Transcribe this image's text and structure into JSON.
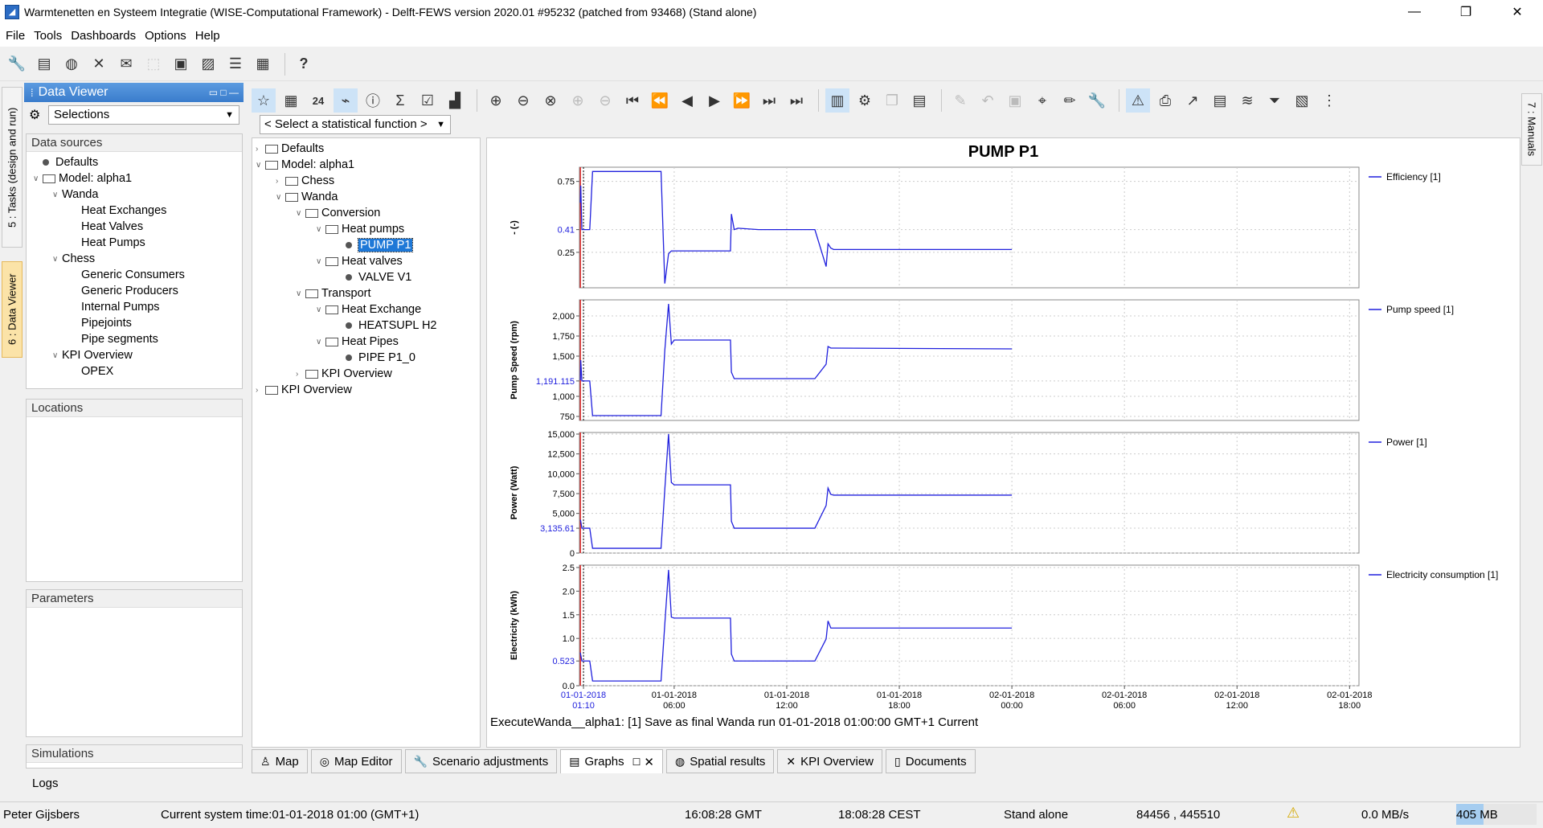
{
  "window": {
    "title": "Warmtenetten en Systeem Integratie (WISE-Computational Framework) - Delft-FEWS version 2020.01 #95232 (patched from 93468)  (Stand alone)"
  },
  "menu": [
    "File",
    "Tools",
    "Dashboards",
    "Options",
    "Help"
  ],
  "side_tabs": {
    "tasks": "5 : Tasks (design and run)",
    "data_viewer": "6 : Data Viewer",
    "manuals": "7 : Manuals"
  },
  "data_viewer": {
    "title": "Data Viewer",
    "selections": "Selections",
    "data_sources_label": "Data sources",
    "data_sources": [
      {
        "label": "Defaults",
        "level": 0,
        "kind": "leaf-dot"
      },
      {
        "label": "Model: alpha1",
        "level": 0,
        "kind": "folder-open"
      },
      {
        "label": "Wanda",
        "level": 1,
        "kind": "open"
      },
      {
        "label": "Heat Exchanges",
        "level": 2,
        "kind": "text"
      },
      {
        "label": "Heat Valves",
        "level": 2,
        "kind": "text"
      },
      {
        "label": "Heat Pumps",
        "level": 2,
        "kind": "text"
      },
      {
        "label": "Chess",
        "level": 1,
        "kind": "open"
      },
      {
        "label": "Generic Consumers",
        "level": 2,
        "kind": "text"
      },
      {
        "label": "Generic Producers",
        "level": 2,
        "kind": "text"
      },
      {
        "label": "Internal Pumps",
        "level": 2,
        "kind": "text"
      },
      {
        "label": "Pipejoints",
        "level": 2,
        "kind": "text"
      },
      {
        "label": "Pipe segments",
        "level": 2,
        "kind": "text"
      },
      {
        "label": "KPI Overview",
        "level": 1,
        "kind": "open"
      },
      {
        "label": "OPEX",
        "level": 2,
        "kind": "text"
      }
    ],
    "locations_label": "Locations",
    "parameters_label": "Parameters",
    "simulations_label": "Simulations"
  },
  "stat_function": "< Select a statistical function >",
  "center_tree": [
    {
      "label": "Defaults",
      "level": 0,
      "kind": "folder-closed"
    },
    {
      "label": "Model: alpha1",
      "level": 0,
      "kind": "folder-open"
    },
    {
      "label": "Chess",
      "level": 1,
      "kind": "folder-closed"
    },
    {
      "label": "Wanda",
      "level": 1,
      "kind": "folder-open"
    },
    {
      "label": "Conversion",
      "level": 2,
      "kind": "folder-open"
    },
    {
      "label": "Heat pumps",
      "level": 3,
      "kind": "folder-open"
    },
    {
      "label": "PUMP P1",
      "level": 4,
      "kind": "leaf-selected"
    },
    {
      "label": "Heat valves",
      "level": 3,
      "kind": "folder-open"
    },
    {
      "label": "VALVE V1",
      "level": 4,
      "kind": "leaf"
    },
    {
      "label": "Transport",
      "level": 2,
      "kind": "folder-open"
    },
    {
      "label": "Heat Exchange",
      "level": 3,
      "kind": "folder-open"
    },
    {
      "label": "HEATSUPL H2",
      "level": 4,
      "kind": "leaf"
    },
    {
      "label": "Heat Pipes",
      "level": 3,
      "kind": "folder-open"
    },
    {
      "label": "PIPE P1_0",
      "level": 4,
      "kind": "leaf"
    },
    {
      "label": "KPI Overview",
      "level": 2,
      "kind": "folder-closed"
    },
    {
      "label": "KPI Overview",
      "level": 0,
      "kind": "folder-closed"
    }
  ],
  "chart_data": {
    "type": "line",
    "title": "PUMP P1",
    "x_ticks": [
      "01-01-2018\n01:10",
      "01-01-2018\n06:00",
      "01-01-2018\n12:00",
      "01-01-2018\n18:00",
      "02-01-2018\n00:00",
      "02-01-2018\n06:00",
      "02-01-2018\n12:00",
      "02-01-2018\n18:00"
    ],
    "x_range_hours": [
      1.0,
      19.0
    ],
    "current_time": "01-01-2018 01:00",
    "panels": [
      {
        "ylabel": "- (-)",
        "legend": "Efficiency [1]",
        "ylim": [
          0.0,
          0.85
        ],
        "y_ticks": [
          "0.75",
          "0.41",
          "0.25"
        ],
        "y_tick_values": [
          0.75,
          0.41,
          0.25
        ],
        "current_value": "0.41",
        "x": [
          1.0,
          1.02,
          1.08,
          1.5,
          1.65,
          5.3,
          5.5,
          5.7,
          5.85,
          6.0,
          9.0,
          9.05,
          9.2,
          9.4,
          10.5,
          13.5,
          14.1,
          14.2,
          14.35,
          14.5,
          24.0
        ],
        "values": [
          0.6,
          0.72,
          0.41,
          0.41,
          0.82,
          0.82,
          0.03,
          0.24,
          0.26,
          0.26,
          0.26,
          0.52,
          0.41,
          0.42,
          0.41,
          0.41,
          0.15,
          0.31,
          0.28,
          0.27,
          0.27
        ]
      },
      {
        "ylabel": "Pump Speed (rpm)",
        "legend": "Pump speed [1]",
        "ylim": [
          700,
          2200
        ],
        "y_ticks": [
          "2,000",
          "1,750",
          "1,500",
          "1,191.115",
          "1,000",
          "750"
        ],
        "y_tick_values": [
          2000,
          1750,
          1500,
          1191.115,
          1000,
          750
        ],
        "current_value": "1,191.115",
        "x": [
          1.0,
          1.02,
          1.08,
          1.5,
          1.65,
          5.3,
          5.5,
          5.7,
          5.85,
          6.0,
          9.0,
          9.05,
          9.2,
          9.4,
          10.5,
          13.5,
          14.1,
          14.2,
          14.35,
          14.5,
          24.0
        ],
        "values": [
          1200,
          1450,
          1191,
          1191,
          760,
          760,
          1570,
          2150,
          1650,
          1700,
          1700,
          1300,
          1220,
          1220,
          1220,
          1220,
          1400,
          1620,
          1600,
          1600,
          1590
        ]
      },
      {
        "ylabel": "Power (Watt)",
        "legend": "Power [1]",
        "ylim": [
          0,
          15200
        ],
        "y_ticks": [
          "15,000",
          "12,500",
          "10,000",
          "7,500",
          "5,000",
          "3,135.61",
          "0"
        ],
        "y_tick_values": [
          15000,
          12500,
          10000,
          7500,
          5000,
          3135.61,
          0
        ],
        "current_value": "3,135.61",
        "x": [
          1.0,
          1.02,
          1.08,
          1.5,
          1.65,
          5.3,
          5.5,
          5.7,
          5.85,
          6.0,
          9.0,
          9.05,
          9.2,
          9.4,
          10.5,
          13.5,
          14.1,
          14.2,
          14.35,
          14.5,
          24.0
        ],
        "values": [
          4200,
          4000,
          3136,
          3136,
          600,
          600,
          8000,
          15000,
          8900,
          8600,
          8600,
          4000,
          3136,
          3136,
          3136,
          3136,
          6000,
          8200,
          7400,
          7300,
          7300
        ]
      },
      {
        "ylabel": "Electricity (kWh)",
        "legend": "Electricity consumption [1]",
        "ylim": [
          0.0,
          2.55
        ],
        "y_ticks": [
          "2.5",
          "2.0",
          "1.5",
          "1.0",
          "0.523",
          "0.0"
        ],
        "y_tick_values": [
          2.5,
          2.0,
          1.5,
          1.0,
          0.523,
          0.0
        ],
        "current_value": "0.523",
        "x": [
          1.0,
          1.02,
          1.08,
          1.5,
          1.65,
          5.3,
          5.5,
          5.7,
          5.85,
          6.0,
          9.0,
          9.05,
          9.2,
          9.4,
          10.5,
          13.5,
          14.1,
          14.2,
          14.35,
          14.5,
          24.0
        ],
        "values": [
          0.7,
          0.65,
          0.523,
          0.523,
          0.1,
          0.1,
          1.3,
          2.45,
          1.45,
          1.43,
          1.43,
          0.67,
          0.523,
          0.523,
          0.523,
          0.523,
          0.99,
          1.37,
          1.22,
          1.22,
          1.22
        ]
      }
    ],
    "series_color": "#2020dd",
    "current_line_color": "#dd0000"
  },
  "graph_status": "ExecuteWanda__alpha1: [1] Save as final Wanda run 01-01-2018 01:00:00 GMT+1 Current",
  "bottom_tabs": [
    {
      "label": "Map",
      "icon": "person-icon"
    },
    {
      "label": "Map Editor",
      "icon": "www-icon"
    },
    {
      "label": "Scenario adjustments",
      "icon": "wrench-icon"
    },
    {
      "label": "Graphs",
      "icon": "graph-icon",
      "active": true
    },
    {
      "label": "Spatial results",
      "icon": "globe-icon"
    },
    {
      "label": "KPI Overview",
      "icon": "tools-icon"
    },
    {
      "label": "Documents",
      "icon": "document-icon"
    }
  ],
  "logs_label": "Logs",
  "status": {
    "user": "Peter Gijsbers",
    "system_time": "Current system time:01-01-2018 01:00 (GMT+1)",
    "gmt": "16:08:28 GMT",
    "cest": "18:08:28 CEST",
    "mode": "Stand alone",
    "coords": "84456 , 445510",
    "rate": "0.0 MB/s",
    "memory": "405 MB"
  }
}
